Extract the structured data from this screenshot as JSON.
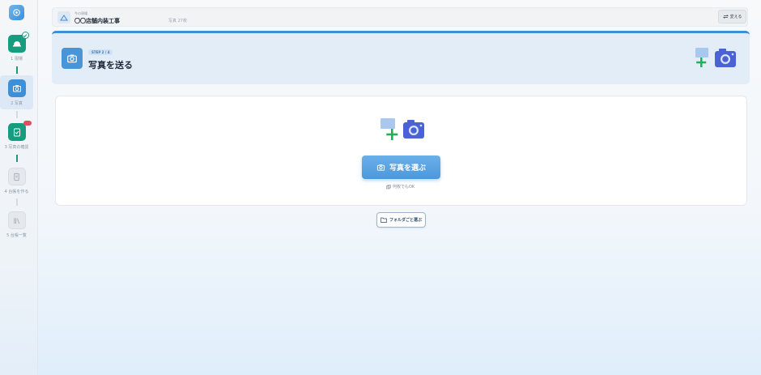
{
  "sidebar": {
    "steps": [
      {
        "label": "1 現場",
        "icon": "hardhat-icon",
        "state": "done"
      },
      {
        "label": "2 写真",
        "icon": "camera-icon",
        "state": "active"
      },
      {
        "label": "3 写真の確認",
        "icon": "clipboard-check-icon",
        "state": "done"
      },
      {
        "label": "4 台帳を作る",
        "icon": "document-icon",
        "state": "todo"
      },
      {
        "label": "5 台帳一覧",
        "icon": "library-icon",
        "state": "todo"
      }
    ]
  },
  "header": {
    "subtitle": "今の現場",
    "project_name": "〇〇店舗内装工事",
    "photo_count": "写真 27枚",
    "change_label": "変える"
  },
  "banner": {
    "step_pill": "STEP 2 / 4",
    "title": "写真を送る"
  },
  "upload": {
    "select_label": "写真を選ぶ",
    "multi_note": "何枚でもOK",
    "folder_label": "フォルダごと選ぶ"
  },
  "colors": {
    "accent": "#3f8fd6",
    "green": "#169c7e",
    "badge_red": "#e04f5f"
  }
}
